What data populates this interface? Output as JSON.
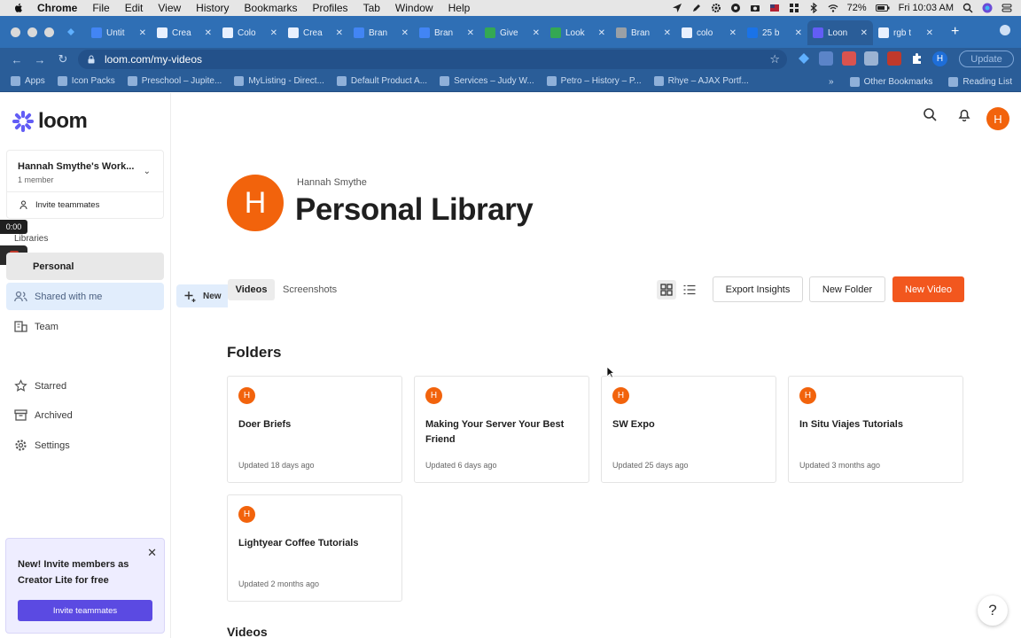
{
  "menubar": {
    "app": "Chrome",
    "items": [
      "File",
      "Edit",
      "View",
      "History",
      "Bookmarks",
      "Profiles",
      "Tab",
      "Window",
      "Help"
    ],
    "battery": "72%",
    "clock": "Fri 10:03 AM"
  },
  "tabs": [
    {
      "label": "Untit",
      "color": "#4285f4"
    },
    {
      "label": "Crea",
      "color": "#e8f0fe"
    },
    {
      "label": "Colo",
      "color": "#e8f0fe"
    },
    {
      "label": "Crea",
      "color": "#e8f0fe"
    },
    {
      "label": "Bran",
      "color": "#4285f4"
    },
    {
      "label": "Bran",
      "color": "#4285f4"
    },
    {
      "label": "Give",
      "color": "#34a853"
    },
    {
      "label": "Look",
      "color": "#34a853"
    },
    {
      "label": "Bran",
      "color": "#9aa0a6"
    },
    {
      "label": "colo",
      "color": "#e8f0fe"
    },
    {
      "label": "25 b",
      "color": "#1a73e8"
    },
    {
      "label": "Loon",
      "color": "#625df5"
    },
    {
      "label": "rgb t",
      "color": "#e8f0fe"
    }
  ],
  "address": {
    "url": "loom.com/my-videos",
    "update_label": "Update",
    "profile_initial": "H"
  },
  "bookmarks": {
    "items": [
      "Apps",
      "Icon Packs",
      "Preschool – Jupite...",
      "MyListing - Direct...",
      "Default Product A...",
      "Services – Judy W...",
      "Petro – History – P...",
      "Rhye – AJAX Portf..."
    ],
    "more": "»",
    "other": "Other Bookmarks",
    "reading": "Reading List"
  },
  "sidebar": {
    "logo": "loom",
    "workspace_name": "Hannah Smythe's Work...",
    "workspace_members": "1 member",
    "invite_label": "Invite teammates",
    "timer": "0:00",
    "libraries_label": "Libraries",
    "nav": {
      "personal": "Personal",
      "shared": "Shared with me",
      "team": "Team",
      "starred": "Starred",
      "archived": "Archived",
      "settings": "Settings"
    },
    "promo": {
      "text": "New! Invite members as Creator Lite for free",
      "button": "Invite teammates"
    }
  },
  "main": {
    "user_initial": "H",
    "owner_name": "Hannah Smythe",
    "title": "Personal Library",
    "new_label": "New",
    "tabs": {
      "videos": "Videos",
      "screenshots": "Screenshots"
    },
    "buttons": {
      "export": "Export Insights",
      "new_folder": "New Folder",
      "new_video": "New Video"
    },
    "folders_title": "Folders",
    "folders": [
      {
        "name": "Doer Briefs",
        "updated": "Updated 18 days ago"
      },
      {
        "name": "Making Your Server Your Best Friend",
        "updated": "Updated 6 days ago"
      },
      {
        "name": "SW Expo",
        "updated": "Updated 25 days ago"
      },
      {
        "name": "In Situ Viajes Tutorials",
        "updated": "Updated 3 months ago"
      },
      {
        "name": "Lightyear Coffee Tutorials",
        "updated": "Updated 2 months ago"
      }
    ],
    "videos_title": "Videos",
    "help": "?"
  },
  "colors": {
    "brand_orange": "#f2630c",
    "new_video": "#f2571e",
    "loom_purple": "#625df5",
    "promo_button": "#5b4ae2"
  }
}
